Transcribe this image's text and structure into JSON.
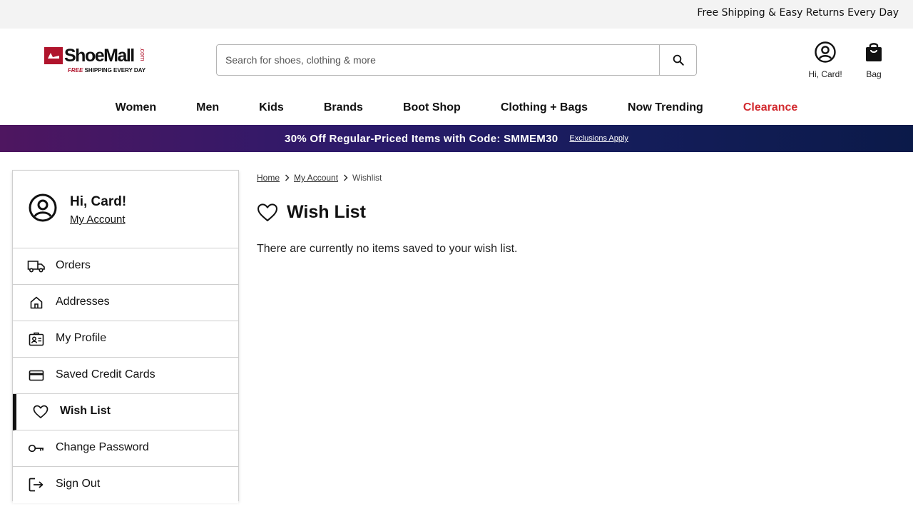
{
  "topbar": {
    "text": "Free Shipping & Easy Returns Every Day"
  },
  "logo": {
    "name": "ShoeMall",
    "com": ".com",
    "tag_free": "FREE",
    "tag_rest": " SHIPPING EVERY DAY"
  },
  "search": {
    "placeholder": "Search for shoes, clothing & more",
    "icon": "search-icon"
  },
  "header": {
    "account_label": "Hi, Card!",
    "bag_label": "Bag"
  },
  "nav": {
    "items": [
      "Women",
      "Men",
      "Kids",
      "Brands",
      "Boot Shop",
      "Clothing + Bags",
      "Now Trending",
      "Clearance"
    ],
    "highlight_color": "#d22a2f"
  },
  "promo": {
    "text": "30% Off Regular-Priced Items with Code: SMMEM30",
    "link": "Exclusions Apply"
  },
  "sidebar": {
    "greeting": "Hi, Card!",
    "account_link": "My Account",
    "items": [
      {
        "label": "Orders",
        "icon": "truck-icon"
      },
      {
        "label": "Addresses",
        "icon": "home-icon"
      },
      {
        "label": "My Profile",
        "icon": "profile-card-icon"
      },
      {
        "label": "Saved Credit Cards",
        "icon": "credit-card-icon"
      },
      {
        "label": "Wish List",
        "icon": "heart-icon",
        "active": true
      },
      {
        "label": "Change Password",
        "icon": "key-icon"
      },
      {
        "label": "Sign Out",
        "icon": "sign-out-icon"
      }
    ]
  },
  "breadcrumb": {
    "items": [
      "Home",
      "My Account",
      "Wishlist"
    ]
  },
  "main": {
    "title": "Wish List",
    "empty_message": "There are currently no items saved to your wish list."
  }
}
